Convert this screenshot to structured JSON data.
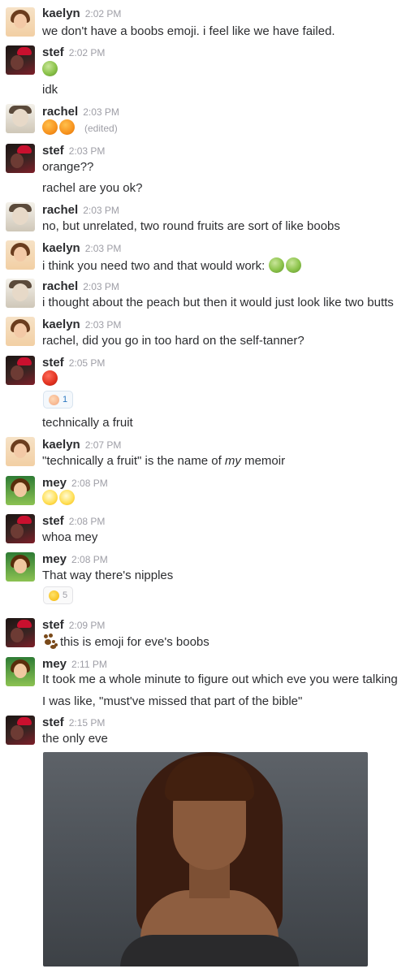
{
  "authors": {
    "kaelyn": "kaelyn",
    "stef": "stef",
    "rachel": "rachel",
    "mey": "mey"
  },
  "messages": [
    {
      "author": "kaelyn",
      "time": "2:02 PM",
      "lines": [
        "we don't have a boobs emoji. i feel like we have failed."
      ]
    },
    {
      "author": "stef",
      "time": "2:02 PM",
      "emoji": [
        "melon"
      ],
      "lines": [
        "idk"
      ]
    },
    {
      "author": "rachel",
      "time": "2:03 PM",
      "emoji": [
        "orange",
        "orange"
      ],
      "edited": "(edited)"
    },
    {
      "author": "stef",
      "time": "2:03 PM",
      "lines": [
        "orange??",
        "rachel are you ok?"
      ]
    },
    {
      "author": "rachel",
      "time": "2:03 PM",
      "lines": [
        "no, but unrelated, two round fruits are sort of like boobs"
      ]
    },
    {
      "author": "kaelyn",
      "time": "2:03 PM",
      "lines": [
        "i think you need two and that would work:"
      ],
      "trailing_emoji": [
        "melon",
        "melon"
      ]
    },
    {
      "author": "rachel",
      "time": "2:03 PM",
      "lines": [
        "i thought about the peach but then it would just look like two butts"
      ]
    },
    {
      "author": "kaelyn",
      "time": "2:03 PM",
      "lines": [
        "rachel, did you go in too hard on the self-tanner?"
      ]
    },
    {
      "author": "stef",
      "time": "2:05 PM",
      "emoji": [
        "tomato"
      ],
      "reaction": {
        "icon": "peach-icon",
        "count": "1"
      },
      "lines": [
        "technically a fruit"
      ]
    },
    {
      "author": "kaelyn",
      "time": "2:07 PM",
      "lines": [
        "\"technically a fruit\" is the name of ",
        "my",
        " memoir"
      ]
    },
    {
      "author": "mey",
      "time": "2:08 PM",
      "emoji": [
        "shine",
        "shine"
      ]
    },
    {
      "author": "stef",
      "time": "2:08 PM",
      "lines": [
        "whoa mey"
      ]
    },
    {
      "author": "mey",
      "time": "2:08 PM",
      "lines": [
        "That way there's nipples"
      ],
      "reaction": {
        "icon": "laughing-icon",
        "count": "5"
      }
    },
    {
      "author": "stef",
      "time": "2:09 PM",
      "lines": [
        "this is emoji for eve's boobs"
      ],
      "leading_emoji": "paw-prints"
    },
    {
      "author": "mey",
      "time": "2:11 PM",
      "lines": [
        "It took me a whole minute to figure out which eve you were talking",
        "I was like, \"must've missed that part of the bible\""
      ]
    },
    {
      "author": "stef",
      "time": "2:15 PM",
      "lines": [
        "the only eve"
      ],
      "image": "photo-of-eve"
    }
  ]
}
